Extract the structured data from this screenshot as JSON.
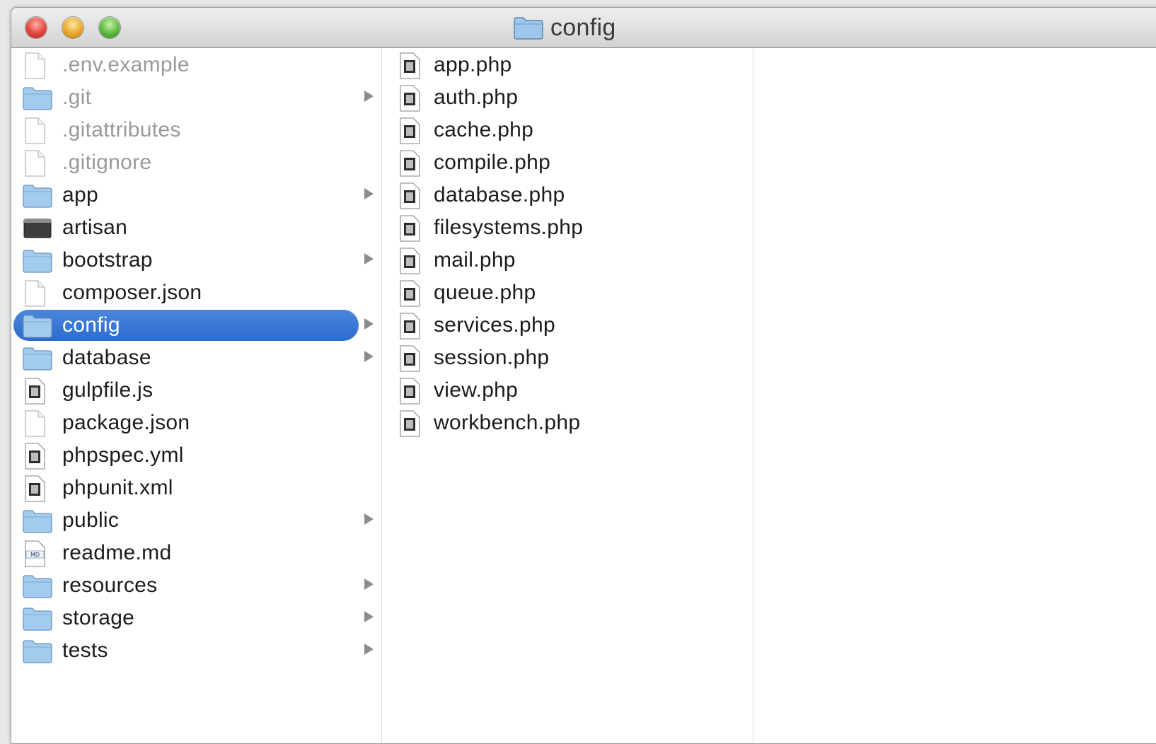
{
  "window": {
    "title": "config"
  },
  "columns": [
    {
      "items": [
        {
          "label": ".env.example",
          "kind": "document",
          "hidden": true,
          "folder": false
        },
        {
          "label": ".git",
          "kind": "folder",
          "hidden": true,
          "folder": true
        },
        {
          "label": ".gitattributes",
          "kind": "document",
          "hidden": true,
          "folder": false
        },
        {
          "label": ".gitignore",
          "kind": "document",
          "hidden": true,
          "folder": false
        },
        {
          "label": "app",
          "kind": "folder",
          "hidden": false,
          "folder": true
        },
        {
          "label": "artisan",
          "kind": "executable",
          "hidden": false,
          "folder": false
        },
        {
          "label": "bootstrap",
          "kind": "folder",
          "hidden": false,
          "folder": true
        },
        {
          "label": "composer.json",
          "kind": "document",
          "hidden": false,
          "folder": false
        },
        {
          "label": "config",
          "kind": "folder",
          "hidden": false,
          "folder": true,
          "selected": true
        },
        {
          "label": "database",
          "kind": "folder",
          "hidden": false,
          "folder": true
        },
        {
          "label": "gulpfile.js",
          "kind": "script",
          "hidden": false,
          "folder": false
        },
        {
          "label": "package.json",
          "kind": "document",
          "hidden": false,
          "folder": false
        },
        {
          "label": "phpspec.yml",
          "kind": "script",
          "hidden": false,
          "folder": false
        },
        {
          "label": "phpunit.xml",
          "kind": "script",
          "hidden": false,
          "folder": false
        },
        {
          "label": "public",
          "kind": "folder",
          "hidden": false,
          "folder": true
        },
        {
          "label": "readme.md",
          "kind": "markdown",
          "hidden": false,
          "folder": false
        },
        {
          "label": "resources",
          "kind": "folder",
          "hidden": false,
          "folder": true
        },
        {
          "label": "storage",
          "kind": "folder",
          "hidden": false,
          "folder": true
        },
        {
          "label": "tests",
          "kind": "folder",
          "hidden": false,
          "folder": true
        }
      ]
    },
    {
      "items": [
        {
          "label": "app.php",
          "kind": "script"
        },
        {
          "label": "auth.php",
          "kind": "script"
        },
        {
          "label": "cache.php",
          "kind": "script"
        },
        {
          "label": "compile.php",
          "kind": "script"
        },
        {
          "label": "database.php",
          "kind": "script"
        },
        {
          "label": "filesystems.php",
          "kind": "script"
        },
        {
          "label": "mail.php",
          "kind": "script"
        },
        {
          "label": "queue.php",
          "kind": "script"
        },
        {
          "label": "services.php",
          "kind": "script"
        },
        {
          "label": "session.php",
          "kind": "script"
        },
        {
          "label": "view.php",
          "kind": "script"
        },
        {
          "label": "workbench.php",
          "kind": "script"
        }
      ]
    },
    {
      "items": []
    }
  ],
  "icons": {
    "close": "close-button-icon",
    "minimize": "minimize-button-icon",
    "zoom": "zoom-button-icon",
    "folder": "folder-icon",
    "document": "document-icon",
    "script": "script-document-icon",
    "executable": "terminal-executable-icon",
    "markdown": "markdown-document-icon",
    "disclosure": "disclosure-chevron-icon"
  },
  "colors": {
    "selection": "#2f6fd3",
    "folder": "#9ec6ea",
    "hidden_text": "#9a9a9a"
  }
}
